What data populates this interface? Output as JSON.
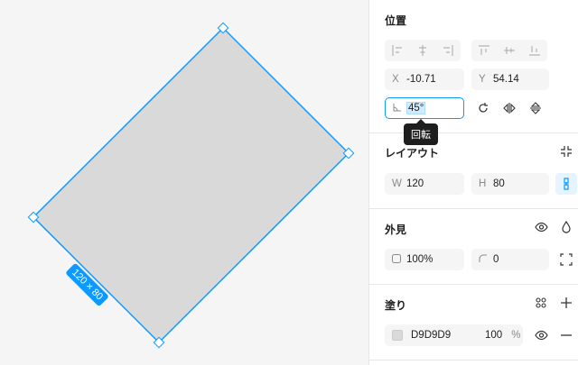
{
  "canvas": {
    "size_label": "120 × 80",
    "fill_color": "#D9D9D9",
    "selection_color": "#0d99ff"
  },
  "position": {
    "title": "位置",
    "x_label": "X",
    "x_value": "-10.71",
    "y_label": "Y",
    "y_value": "54.14",
    "rotation_value": "45°",
    "tooltip": "回転",
    "align_icons": [
      "align-left-icon",
      "align-center-h-icon",
      "align-right-icon",
      "align-top-icon",
      "align-middle-v-icon",
      "align-bottom-icon"
    ],
    "transform_icons": [
      "rotate-icon",
      "flip-horizontal-icon",
      "flip-vertical-icon"
    ]
  },
  "layout": {
    "title": "レイアウト",
    "w_label": "W",
    "w_value": "120",
    "h_label": "H",
    "h_value": "80"
  },
  "appearance": {
    "title": "外見",
    "opacity_value": "100%",
    "radius_value": "0"
  },
  "fill": {
    "title": "塗り",
    "hex": "D9D9D9",
    "opacity": "100",
    "percent": "%"
  }
}
